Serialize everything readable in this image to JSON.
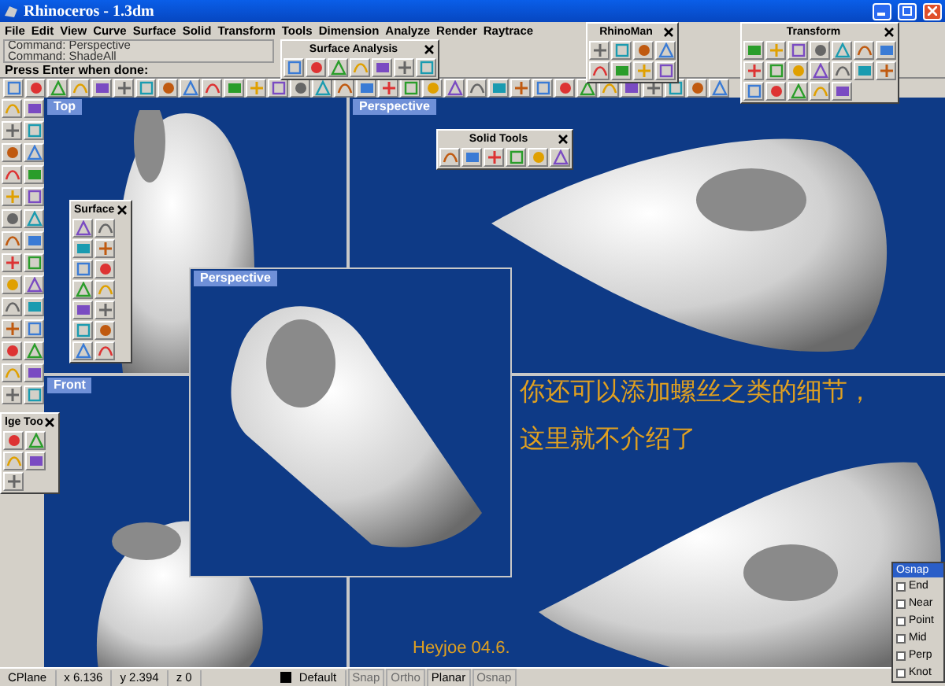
{
  "window": {
    "title": "Rhinoceros - 1.3dm"
  },
  "menu": [
    "File",
    "Edit",
    "View",
    "Curve",
    "Surface",
    "Solid",
    "Transform",
    "Tools",
    "Dimension",
    "Analyze",
    "Render",
    "Raytrace"
  ],
  "command_history": [
    "Command: Perspective",
    "Command: ShadeAll"
  ],
  "command_prompt": "Press Enter when done:",
  "floating_toolbars": [
    {
      "title": "Surface Analysis"
    },
    {
      "title": "RhinoMan"
    },
    {
      "title": "Transform"
    },
    {
      "title": "Solid Tools"
    },
    {
      "title": "Surface"
    },
    {
      "title": "lge Too"
    }
  ],
  "viewports": [
    {
      "label": "Top"
    },
    {
      "label": "Perspective"
    },
    {
      "label": "Front"
    }
  ],
  "floating_viewport": {
    "label": "Perspective"
  },
  "caption": [
    "你还可以添加螺丝之类的细节，",
    "这里就不介绍了"
  ],
  "signature": "Heyjoe  04.6.",
  "osnap": {
    "title": "Osnap",
    "items": [
      {
        "label": "End",
        "checked": false
      },
      {
        "label": "Near",
        "checked": false
      },
      {
        "label": "Point",
        "checked": false
      },
      {
        "label": "Mid",
        "checked": false
      },
      {
        "label": "Perp",
        "checked": false
      },
      {
        "label": "Knot",
        "checked": false
      }
    ]
  },
  "status_bar": {
    "cplane": "CPlane",
    "x": "x 6.136",
    "y": "y 2.394",
    "z": "z 0",
    "layer": "Default",
    "toggles": [
      {
        "label": "Snap",
        "on": false
      },
      {
        "label": "Ortho",
        "on": false
      },
      {
        "label": "Planar",
        "on": true
      },
      {
        "label": "Osnap",
        "on": false
      }
    ]
  }
}
